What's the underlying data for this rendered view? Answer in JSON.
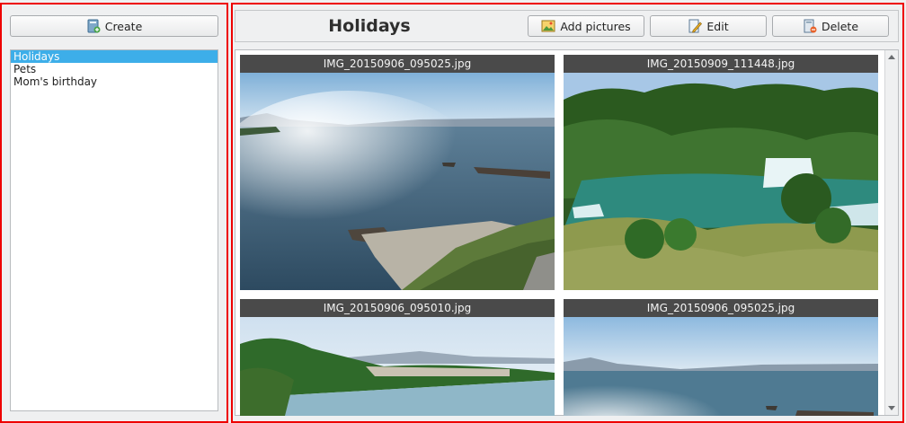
{
  "annotations": {
    "left_number": "1",
    "right_number": "2"
  },
  "sidebar": {
    "create_label": "Create",
    "albums": [
      {
        "label": "Holidays",
        "selected": true
      },
      {
        "label": "Pets",
        "selected": false
      },
      {
        "label": "Mom's birthday",
        "selected": false
      }
    ]
  },
  "header": {
    "title": "Holidays",
    "add_pictures_label": "Add pictures",
    "edit_label": "Edit",
    "delete_label": "Delete"
  },
  "photos": [
    {
      "filename": "IMG_20150906_095025.jpg"
    },
    {
      "filename": "IMG_20150909_111448.jpg"
    },
    {
      "filename": "IMG_20150906_095010.jpg"
    },
    {
      "filename": "IMG_20150906_095025.jpg"
    }
  ],
  "icons": {
    "create": "album-add-icon",
    "add_pictures": "add-image-icon",
    "edit": "edit-document-icon",
    "delete": "delete-document-icon"
  }
}
